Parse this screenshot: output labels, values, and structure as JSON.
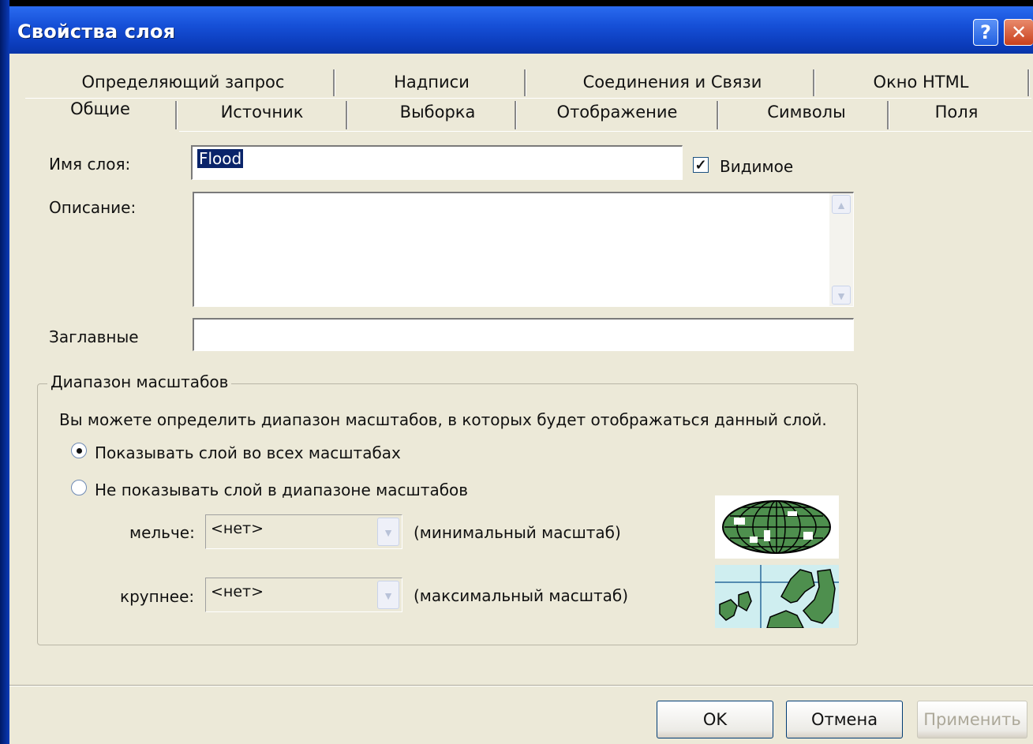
{
  "window": {
    "title": "Свойства слоя",
    "help_glyph": "?",
    "close_glyph": "✕"
  },
  "tabs": {
    "top_row": [
      "Определяющий запрос",
      "Надписи",
      "Соединения и Связи",
      "Окно HTML"
    ],
    "bottom_row": [
      "Общие",
      "Источник",
      "Выборка",
      "Отображение",
      "Символы",
      "Поля"
    ],
    "active": "Общие"
  },
  "general": {
    "layer_name_label": "Имя слоя:",
    "layer_name_value": "Flood",
    "visible_label": "Видимое",
    "visible_checked": true,
    "description_label": "Описание:",
    "description_value": "",
    "credits_label": "Заглавные",
    "credits_value": ""
  },
  "scale_range": {
    "legend": "Диапазон масштабов",
    "info": "Вы можете определить диапазон масштабов, в которых будет отображаться данный слой.",
    "option_all": "Показывать слой во всех масштабах",
    "option_range": "Не показывать слой в диапазоне масштабов",
    "selected_option": "all",
    "min_label": "мельче:",
    "min_value": "<нет>",
    "min_note": "(минимальный масштаб)",
    "max_label": "крупнее:",
    "max_value": "<нет>",
    "max_note": "(максимальный масштаб)"
  },
  "buttons": {
    "ok": "OK",
    "cancel": "Отмена",
    "apply": "Применить"
  },
  "icons": {
    "globe": "world-map-icon",
    "europe": "europe-map-icon",
    "scroll_up": "▲",
    "scroll_down": "▼",
    "dropdown": "▼"
  },
  "colors": {
    "titlebar": "#0a3ab8",
    "dialog": "#ece9d8",
    "selection": "#0a246a",
    "map_water": "#cfeef0",
    "map_land": "#4e8f4e"
  }
}
